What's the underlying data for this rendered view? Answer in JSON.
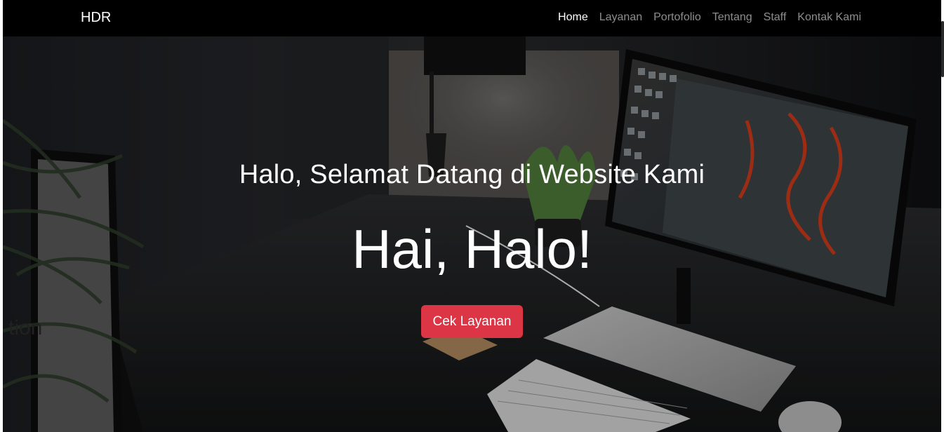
{
  "navbar": {
    "brand": "HDR",
    "items": [
      {
        "label": "Home",
        "active": true
      },
      {
        "label": "Layanan",
        "active": false
      },
      {
        "label": "Portofolio",
        "active": false
      },
      {
        "label": "Tentang",
        "active": false
      },
      {
        "label": "Staff",
        "active": false
      },
      {
        "label": "Kontak Kami",
        "active": false
      }
    ]
  },
  "hero": {
    "lead": "Halo, Selamat Datang di Website Kami",
    "title": "Hai, Halo!",
    "button": "Cek Layanan",
    "background_text": "tion"
  },
  "colors": {
    "navbar": "#000000",
    "button": "#dc3545",
    "text": "#ffffff"
  }
}
